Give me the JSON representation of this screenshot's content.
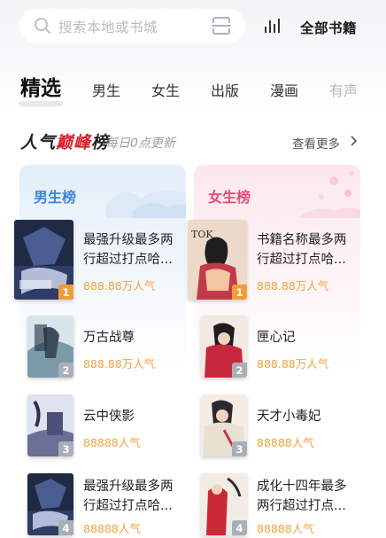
{
  "search": {
    "placeholder": "搜索本地或书城"
  },
  "header": {
    "all_books": "全部书籍"
  },
  "tabs": [
    {
      "label": "精选"
    },
    {
      "label": "男生"
    },
    {
      "label": "女生"
    },
    {
      "label": "出版"
    },
    {
      "label": "漫画"
    },
    {
      "label": "有声"
    }
  ],
  "section": {
    "title_a": "人气",
    "title_b": "巅峰",
    "title_c": "榜",
    "subtitle": "每日0点更新",
    "more": "查看更多"
  },
  "male": {
    "title": "男生榜",
    "books": [
      {
        "rank": "1",
        "title_1": "最强升级最多两",
        "title_2": "行超过打点哈...",
        "heat": "888.88万人气"
      },
      {
        "rank": "2",
        "title_1": "万古战尊",
        "title_2": "",
        "heat": "888.88万人气"
      },
      {
        "rank": "3",
        "title_1": "云中侠影",
        "title_2": "",
        "heat": "88888人气"
      },
      {
        "rank": "4",
        "title_1": "最强升级最多两",
        "title_2": "行超过打点哈...",
        "heat": "88888人气"
      }
    ]
  },
  "female": {
    "title": "女生榜",
    "books": [
      {
        "rank": "1",
        "title_1": "书籍名称最多两",
        "title_2": "行超过打点哈...",
        "heat": "888.88万人气"
      },
      {
        "rank": "2",
        "title_1": "匣心记",
        "title_2": "",
        "heat": "888.88万人气"
      },
      {
        "rank": "3",
        "title_1": "天才小毒妃",
        "title_2": "",
        "heat": "88888人气"
      },
      {
        "rank": "4",
        "title_1": "成化十四年最多",
        "title_2": "两行超过打点...",
        "heat": "88888人气"
      }
    ]
  },
  "colors": {
    "accent_red": "#d8202b",
    "male_blue": "#3d86d6",
    "female_pink": "#e84c77",
    "heat_orange": "#f0a23b",
    "rank1_orange": "#f29c38"
  },
  "icons": [
    "search-icon",
    "scan-icon",
    "ranking-icon",
    "chevron-right-icon"
  ]
}
